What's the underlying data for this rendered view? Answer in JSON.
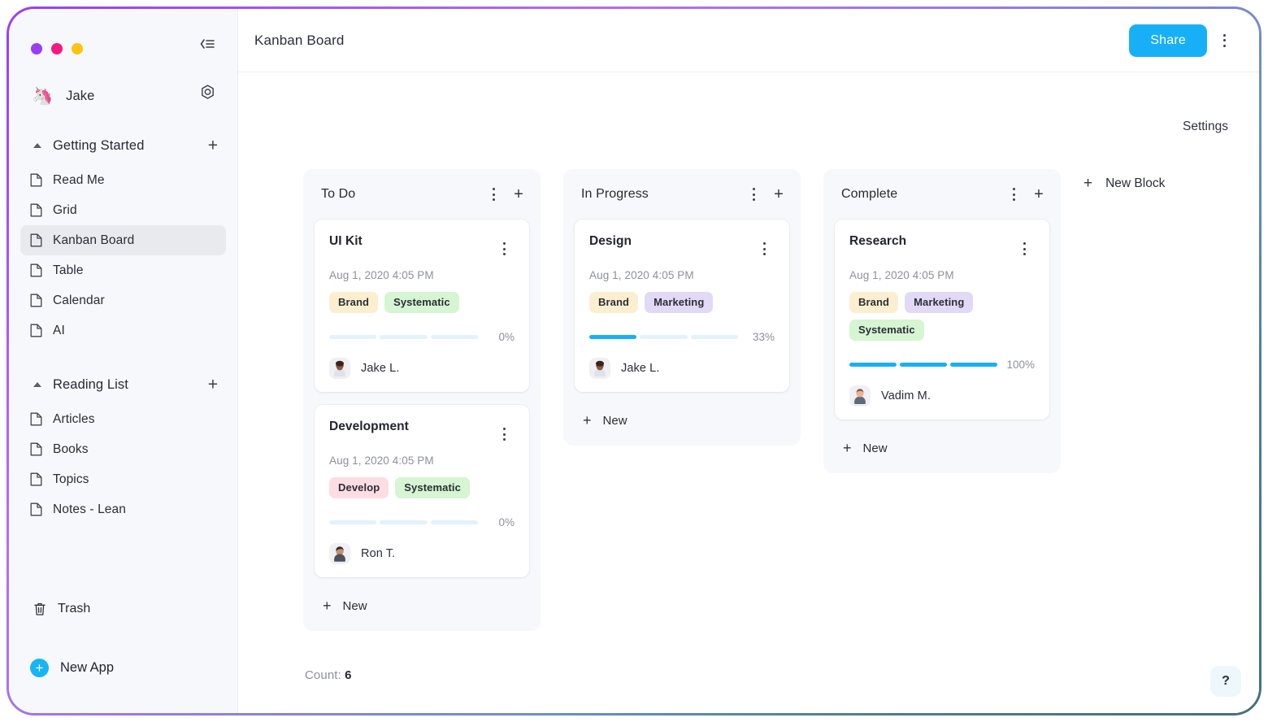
{
  "window": {
    "dots": [
      "purple",
      "pink",
      "yellow"
    ],
    "collapse_icon": "collapse-sidebar-icon"
  },
  "sidebar": {
    "user": {
      "name": "Jake",
      "avatar_icon": "unicorn-emoji",
      "settings_icon": "gear-icon"
    },
    "groups": [
      {
        "title": "Getting Started",
        "add_label": "+",
        "items": [
          {
            "label": "Read Me",
            "active": false
          },
          {
            "label": "Grid",
            "active": false
          },
          {
            "label": "Kanban Board",
            "active": true
          },
          {
            "label": "Table",
            "active": false
          },
          {
            "label": "Calendar",
            "active": false
          },
          {
            "label": "AI",
            "active": false
          }
        ]
      },
      {
        "title": "Reading List",
        "add_label": "+",
        "items": [
          {
            "label": "Articles",
            "active": false
          },
          {
            "label": "Books",
            "active": false
          },
          {
            "label": "Topics",
            "active": false
          },
          {
            "label": "Notes - Lean",
            "active": false
          }
        ]
      }
    ],
    "trash": {
      "label": "Trash",
      "icon": "trash-icon"
    },
    "new_app": {
      "label": "New App",
      "icon": "plus-circle-icon"
    }
  },
  "topbar": {
    "title": "Kanban Board",
    "share_label": "Share",
    "menu_icon": "kebab-menu-icon"
  },
  "board": {
    "settings_label": "Settings",
    "new_block_label": "New Block",
    "new_label": "New",
    "count_label": "Count:",
    "count_value": "6",
    "help_label": "?",
    "columns": [
      {
        "title": "To Do",
        "cards": [
          {
            "title": "UI Kit",
            "date": "Aug 1, 2020 4:05 PM",
            "tags": [
              {
                "label": "Brand",
                "color": "#fcefd0"
              },
              {
                "label": "Systematic",
                "color": "#d6f5d2"
              }
            ],
            "progress": 0,
            "progress_label": "0%",
            "segments_filled": 0,
            "assignee": "Jake L."
          },
          {
            "title": "Development",
            "date": "Aug 1, 2020 4:05 PM",
            "tags": [
              {
                "label": "Develop",
                "color": "#fcdde4"
              },
              {
                "label": "Systematic",
                "color": "#d6f5d2"
              }
            ],
            "progress": 0,
            "progress_label": "0%",
            "segments_filled": 0,
            "assignee": "Ron T."
          }
        ]
      },
      {
        "title": "In Progress",
        "cards": [
          {
            "title": "Design",
            "date": "Aug 1, 2020 4:05 PM",
            "tags": [
              {
                "label": "Brand",
                "color": "#fcefd0"
              },
              {
                "label": "Marketing",
                "color": "#e2d9f7"
              }
            ],
            "progress": 33,
            "progress_label": "33%",
            "segments_filled": 1,
            "assignee": "Jake L."
          }
        ]
      },
      {
        "title": "Complete",
        "cards": [
          {
            "title": "Research",
            "date": "Aug 1, 2020 4:05 PM",
            "tags": [
              {
                "label": "Brand",
                "color": "#fcefd0"
              },
              {
                "label": "Marketing",
                "color": "#e2d9f7"
              },
              {
                "label": "Systematic",
                "color": "#d6f5d2"
              }
            ],
            "progress": 100,
            "progress_label": "100%",
            "segments_filled": 3,
            "assignee": "Vadim M."
          }
        ]
      }
    ]
  },
  "colors": {
    "accent": "#17b0f6",
    "sidebar_bg": "#f7f8fc",
    "column_bg": "#f7f8fb",
    "frame_start": "#9b3df5",
    "frame_end": "#41707d"
  }
}
